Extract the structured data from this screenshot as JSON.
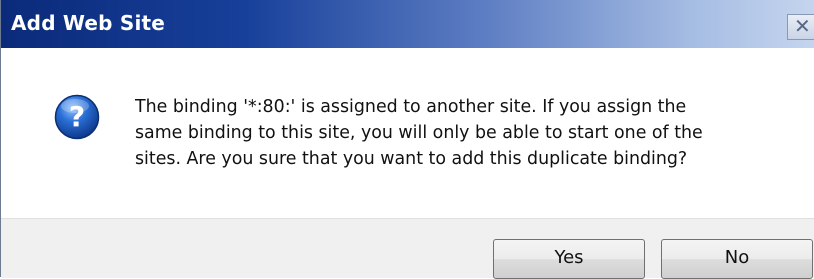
{
  "window": {
    "title": "Add Web Site",
    "close_label": "✕"
  },
  "dialog": {
    "icon": "question-icon",
    "message_lines": [
      "The binding '*:80:' is assigned to another site. If you assign the",
      "same binding to this site, you will only be able to start one of the",
      "sites. Are you sure that you want to add this duplicate binding?"
    ]
  },
  "buttons": {
    "yes_label": "Yes",
    "no_label": "No"
  },
  "colors": {
    "titlebar_start": "#0b2a7a",
    "titlebar_end": "#c5d5ee",
    "icon_blue": "#1f5bbf"
  }
}
